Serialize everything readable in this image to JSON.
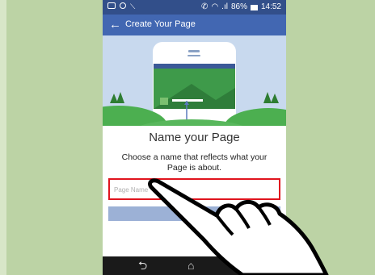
{
  "status_bar": {
    "battery": "86%",
    "time": "14:52"
  },
  "app_bar": {
    "title": "Create Your Page",
    "back_icon": "back-arrow-icon"
  },
  "main": {
    "heading": "Name your Page",
    "subtitle": "Choose a name that reflects what your Page is about.",
    "name_input": {
      "placeholder": "Page Name",
      "value": ""
    }
  },
  "nav_bar": {
    "back": "⮌",
    "home": "⌂",
    "recents": "❐"
  },
  "colors": {
    "status_bar": "#324f8a",
    "app_bar": "#4267b2",
    "input_highlight": "#e0141e",
    "button": "#9cb1d6",
    "background": "#bcd3a5"
  }
}
